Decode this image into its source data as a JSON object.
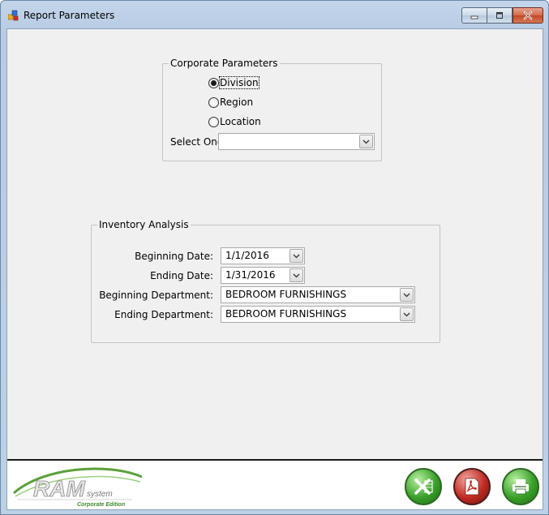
{
  "window": {
    "title": "Report Parameters",
    "icon": "app-icon",
    "controls": {
      "minimize": "minimize-icon",
      "maximize": "maximize-icon",
      "close": "close-icon"
    }
  },
  "corporate": {
    "legend": "Corporate Parameters",
    "options": [
      {
        "label": "Division",
        "checked": true
      },
      {
        "label": "Region",
        "checked": false
      },
      {
        "label": "Location",
        "checked": false
      }
    ],
    "select_label": "Select One:",
    "select_value": ""
  },
  "inventory": {
    "legend": "Inventory Analysis",
    "beginning_date_label": "Beginning Date:",
    "beginning_date_value": "1/1/2016",
    "ending_date_label": "Ending Date:",
    "ending_date_value": "1/31/2016",
    "beginning_dept_label": "Beginning Department:",
    "beginning_dept_value": "BEDROOM FURNISHINGS",
    "ending_dept_label": "Ending Department:",
    "ending_dept_value": "BEDROOM FURNISHINGS"
  },
  "footer": {
    "logo": {
      "text": "RAM",
      "suffix": "system",
      "edition": "Corporate Edition"
    },
    "buttons": [
      {
        "name": "export-excel-button",
        "icon": "excel-icon",
        "color": "#3aa02a"
      },
      {
        "name": "export-pdf-button",
        "icon": "pdf-icon",
        "color": "#c02a22"
      },
      {
        "name": "print-button",
        "icon": "printer-icon",
        "color": "#3aa02a"
      }
    ]
  }
}
